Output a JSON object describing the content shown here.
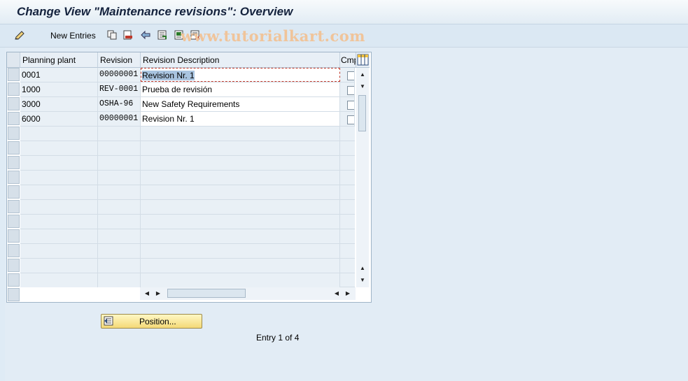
{
  "title": "Change View \"Maintenance revisions\": Overview",
  "toolbar": {
    "new_entries_label": "New Entries",
    "icons": [
      "display-change-icon",
      "copy-icon",
      "delete-icon",
      "undo-icon",
      "select-all-icon",
      "select-block-icon",
      "deselect-all-icon"
    ]
  },
  "watermark": "www.tutorialkart.com",
  "table": {
    "columns": [
      "Planning plant",
      "Revision",
      "Revision Description",
      "Cmp"
    ],
    "rows": [
      {
        "plant": "0001",
        "revision": "00000001",
        "description": "Revision Nr. 1",
        "completed": false
      },
      {
        "plant": "1000",
        "revision": "REV-0001",
        "description": "Prueba de revisión",
        "completed": false
      },
      {
        "plant": "3000",
        "revision": "OSHA-96",
        "description": "New Safety Requirements",
        "completed": false
      },
      {
        "plant": "6000",
        "revision": "00000001",
        "description": "Revision Nr. 1",
        "completed": false
      }
    ]
  },
  "position_button": {
    "label": "Position..."
  },
  "entry_info": "Entry 1 of 4",
  "colors": {
    "accent": "#f4d977",
    "header": "#e8eff6",
    "background": "#dfebf5"
  }
}
